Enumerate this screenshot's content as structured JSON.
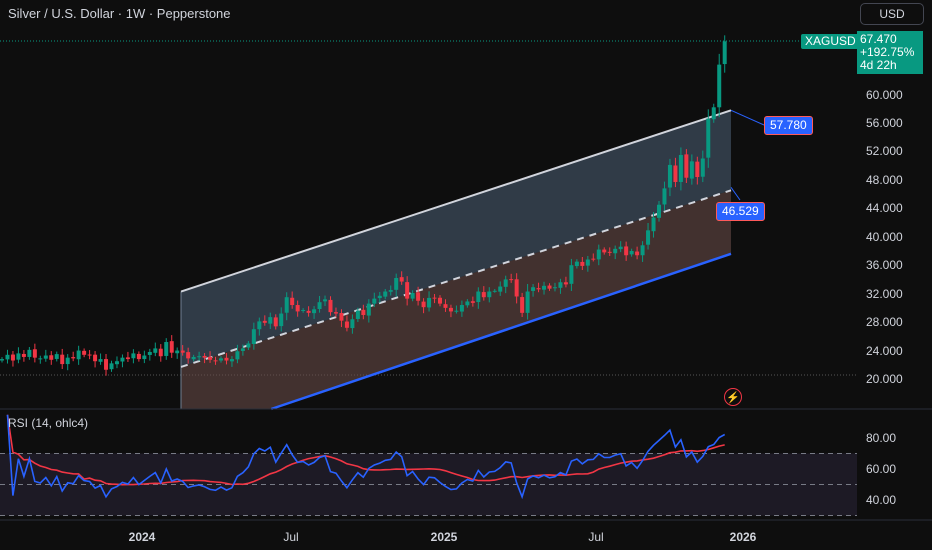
{
  "header": {
    "title": "Silver / U.S. Dollar · 1W · Pepperstone",
    "currency_button": "USD",
    "rsi_title": "RSI (14, ohlc4)"
  },
  "price_tags": {
    "symbol": "XAGUSD",
    "last_price": "67.470",
    "change": "+192.75%",
    "countdown": "4d 22h",
    "upper_level": "57.780",
    "middle_level": "46.529"
  },
  "icons": {
    "flash": "lightning-icon"
  },
  "colors": {
    "background": "#0e0e0e",
    "up_candle": "#089981",
    "down_candle": "#f23645",
    "rsi_line": "#2962ff",
    "rsi_ma": "#f23645",
    "channel_upper_line": "#d1d4dc",
    "channel_lower_line": "#2962ff"
  },
  "chart_data": [
    {
      "type": "candlestick",
      "title": "Silver / U.S. Dollar · 1W · Pepperstone",
      "symbol": "XAGUSD",
      "price_axis_ticks": [
        60,
        56,
        52,
        48,
        44,
        40,
        36,
        32,
        28,
        24,
        20
      ],
      "price_axis_labels": [
        "60.000",
        "56.000",
        "52.000",
        "48.000",
        "44.000",
        "40.000",
        "36.000",
        "32.000",
        "28.000",
        "24.000",
        "20.000"
      ],
      "ylim": [
        16,
        68.5
      ],
      "time_axis_labels": [
        "2024",
        "Jul",
        "2025",
        "Jul",
        "2026"
      ],
      "last_price": 67.47,
      "grid": false,
      "regression_channel": {
        "start_date": "2024-03-01",
        "end_date": "2025-12-20",
        "upper": [
          32.3,
          57.78
        ],
        "middle": [
          21.7,
          46.529
        ],
        "lower": [
          11.5,
          37.6
        ]
      },
      "closes": [
        22.8,
        23.4,
        22.6,
        23.6,
        23.1,
        24.1,
        23.0,
        22.9,
        23.3,
        22.7,
        23.5,
        22.1,
        23.0,
        22.9,
        24.0,
        23.4,
        23.3,
        22.5,
        22.8,
        21.3,
        22.2,
        22.5,
        23.0,
        22.8,
        23.6,
        22.8,
        23.3,
        23.8,
        24.3,
        23.2,
        25.2,
        23.7,
        24.0,
        23.7,
        22.9,
        23.1,
        23.2,
        23.0,
        22.7,
        22.6,
        22.9,
        22.6,
        22.8,
        23.9,
        24.3,
        25.0,
        27.0,
        28.1,
        27.9,
        28.7,
        27.4,
        29.2,
        31.5,
        30.4,
        29.5,
        29.7,
        29.3,
        29.8,
        30.8,
        31.2,
        29.4,
        29.2,
        28.2,
        27.2,
        28.4,
        29.6,
        29.0,
        30.6,
        31.3,
        31.7,
        32.3,
        32.5,
        34.2,
        33.7,
        31.3,
        32.1,
        31.0,
        30.1,
        31.4,
        31.3,
        30.6,
        30.0,
        29.5,
        29.6,
        30.4,
        30.9,
        30.7,
        32.3,
        31.5,
        32.3,
        32.4,
        33.0,
        34.0,
        33.9,
        31.6,
        29.3,
        32.3,
        32.9,
        32.6,
        33.1,
        32.7,
        32.9,
        33.6,
        33.3,
        36.0,
        36.5,
        35.9,
        36.8,
        36.9,
        38.2,
        37.8,
        37.8,
        38.3,
        38.6,
        37.4,
        38.0,
        37.4,
        38.8,
        40.9,
        42.7,
        44.5,
        46.8,
        50.1,
        47.7,
        51.5,
        48.3,
        50.6,
        48.4,
        51.0,
        56.6,
        58.2,
        64.2,
        67.47
      ],
      "rsi": {
        "title": "RSI (14, ohlc4)",
        "length": 14,
        "source": "ohlc4",
        "axis_ticks": [
          80,
          60,
          40
        ],
        "axis_labels": [
          "80.00",
          "60.00",
          "40.00"
        ],
        "band_upper": 70,
        "band_lower": 30,
        "ylim": [
          20,
          100
        ]
      }
    }
  ]
}
